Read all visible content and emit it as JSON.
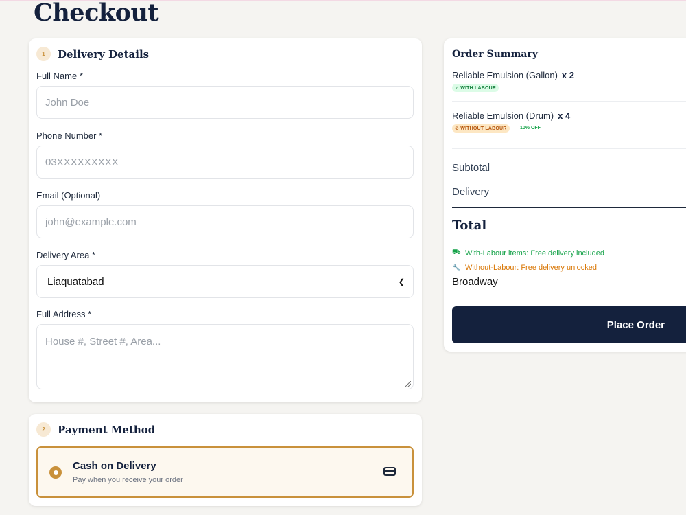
{
  "page": {
    "title": "Checkout"
  },
  "delivery": {
    "step": "1",
    "title": "Delivery Details",
    "full_name": {
      "label": "Full Name *",
      "placeholder": "John Doe"
    },
    "phone": {
      "label": "Phone Number *",
      "placeholder": "03XXXXXXXXX"
    },
    "email": {
      "label": "Email (Optional)",
      "placeholder": "john@example.com"
    },
    "area": {
      "label": "Delivery Area *",
      "value": "Liaquatabad"
    },
    "address": {
      "label": "Full Address *",
      "placeholder": "House #, Street #, Area..."
    }
  },
  "payment": {
    "step": "2",
    "title": "Payment Method",
    "option": {
      "title": "Cash on Delivery",
      "subtitle": "Pay when you receive your order",
      "icon": "credit-card-icon",
      "selected": true
    }
  },
  "summary": {
    "title": "Order Summary",
    "items": [
      {
        "name": "Reliable Emulsion (Gallon)",
        "qty": "x 2",
        "tag": "✓ WITH LABOUR"
      },
      {
        "name": "Reliable Emulsion (Drum)",
        "qty": "x 4",
        "tag": "⊘ WITHOUT LABOUR",
        "discount": "10% OFF"
      }
    ],
    "subtotal_label": "Subtotal",
    "delivery_label": "Delivery",
    "total_label": "Total",
    "notes": [
      {
        "text": "With-Labour items: Free delivery included",
        "icon": "truck-icon"
      },
      {
        "text": "Without-Labour: Free delivery unlocked",
        "icon": "wrench-icon"
      }
    ],
    "area": "Broadway",
    "place_order": "Place Order"
  },
  "colors": {
    "navy": "#14213d",
    "gold": "#c9913b",
    "green": "#16a34a",
    "amber": "#d97706"
  }
}
